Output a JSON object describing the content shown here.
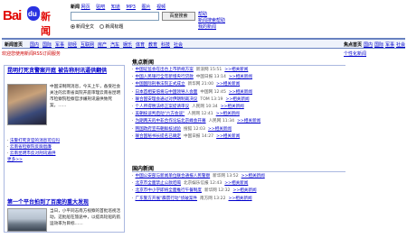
{
  "brand": {
    "logo_text_bai": "Bai",
    "logo_text_du": "du",
    "logo_text_news": "新闻"
  },
  "topnav": {
    "items": [
      "新闻",
      "网页",
      "贴吧",
      "知道",
      "MP3",
      "图片",
      "视频"
    ],
    "current": "新闻"
  },
  "search": {
    "placeholder": "",
    "button_label": "百度搜索",
    "radio_all": "新闻全文",
    "radio_title": "新闻标题"
  },
  "toplinks": [
    "帮助",
    "新闻搜索帮助",
    "我的新闻"
  ],
  "navbar": {
    "items": [
      "新闻首页",
      "国内",
      "国际",
      "军事",
      "财经",
      "互联网",
      "房产",
      "汽车",
      "娱乐",
      "体育",
      "教育",
      "科技",
      "社会"
    ],
    "right_items": [
      "焦点首页",
      "国内",
      "国际",
      "军事",
      "社会"
    ]
  },
  "subbar": {
    "left": "欢迎您使用新闻RSS订阅服务",
    "right": "个性化新闻"
  },
  "left": {
    "headline1": "昆明打死贪警案开庭 被告称刑讯逼供翻供",
    "intro1": "中国法制网消息，今天上午，备受社会关注的云南省高院开庭审理云南省昆明市检察院检察官涉嫌刑讯逼供致死案，……",
    "list1": [
      "法警打死贪官的消息可信吗",
      "云南省检察院反腐倡廉",
      "云南昆明市反对刑讯逼供"
    ],
    "more1": "更多>>",
    "headline2": "第一个平台拍到了百度的重大发现",
    "intro2": "当日，小平同志南方视察的首批巡视活动，这批船在旅途中，以提高轮船的航运效率为目标……"
  },
  "center": {
    "section1": "焦点新闻",
    "news1": [
      {
        "t": "中国证监会在出台上市新规方案",
        "src": "新浪网 15:51",
        "rel": ">>相关新闻"
      },
      {
        "t": "中国人民银行全年新增央行贷款",
        "src": "中国日报 13:14",
        "rel": ">>相关新闻"
      },
      {
        "t": "中国国际刑事法院正式成立",
        "src": "新华网 21:00",
        "rel": ">>相关新闻"
      },
      {
        "t": "日本首相安倍将与中国领导人会面",
        "src": "中国网 12:45",
        "rel": ">>相关新闻"
      },
      {
        "t": "联合国安理会通过对伊朗制裁决议",
        "src": "TOM 13:19",
        "rel": ">>相关新闻"
      },
      {
        "t": "个人所得税法修正案提请审议",
        "src": "人民网 10:34",
        "rel": ">>相关新闻"
      },
      {
        "t": "美朝核谈判启动\"六方会谈\"",
        "src": "人民网 12:41",
        "rel": ">>相关新闻"
      },
      {
        "t": "为期两天的中非合作论坛北京峰会开幕",
        "src": "人民网 11:34",
        "rel": ">>相关新闻"
      },
      {
        "t": "韩国政府宣布朝鲜核试验",
        "src": "搜狐 12:03",
        "rel": ">>相关新闻"
      },
      {
        "t": "联合国秘书长提名已确定",
        "src": "中国日报 14:27",
        "rel": ">>相关新闻"
      }
    ],
    "section2": "国内新闻",
    "news2": [
      {
        "t": "中国公安部与新闻单位联合通报人民警察",
        "src": "新华网 13:52",
        "rel": ">>相关新闻"
      },
      {
        "t": "北京市全面禁止公款吃喝",
        "src": "北京娱乐信报 12:43",
        "rel": ">>相关新闻"
      },
      {
        "t": "北京市中小学即将全面推行午餐制度",
        "src": "新华网 12:32",
        "rel": ">>相关新闻"
      },
      {
        "t": "广东警方开展\"霹雳行动\"侦破案件",
        "src": "南方网 13:22",
        "rel": ">>相关新闻"
      }
    ]
  },
  "colors": {
    "link": "#0000cc",
    "accent": "#e10602",
    "rule": "#aab8e0"
  }
}
